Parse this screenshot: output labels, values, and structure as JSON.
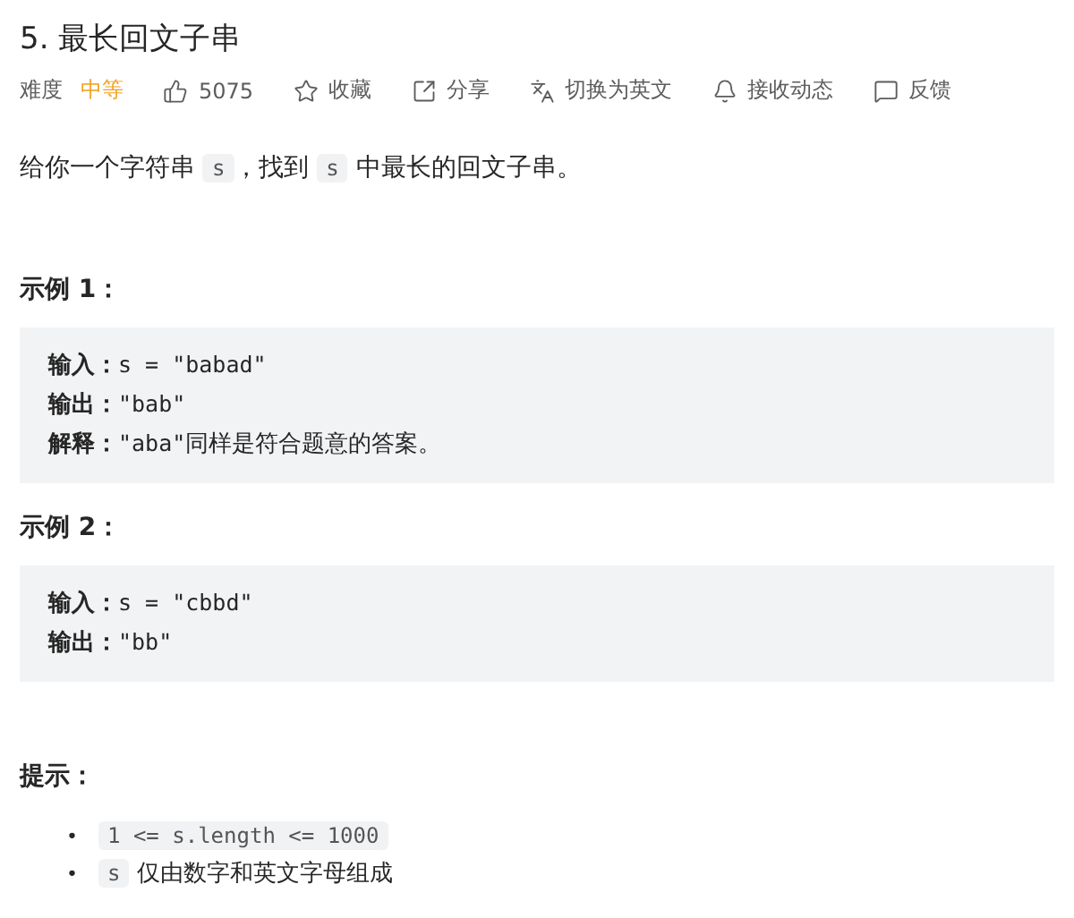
{
  "title": "5. 最长回文子串",
  "difficulty": {
    "label": "难度",
    "value": "中等"
  },
  "actions": [
    {
      "label": "5075"
    },
    {
      "label": "收藏"
    },
    {
      "label": "分享"
    },
    {
      "label": "切换为英文"
    },
    {
      "label": "接收动态"
    },
    {
      "label": "反馈"
    }
  ],
  "description": [
    {
      "kind": "text",
      "text": "给你一个字符串 "
    },
    {
      "kind": "code",
      "text": "s"
    },
    {
      "kind": "text",
      "text": "，找到 "
    },
    {
      "kind": "code",
      "text": "s"
    },
    {
      "kind": "text",
      "text": " 中最长的回文子串。"
    }
  ],
  "examples": [
    {
      "heading": "示例 1：",
      "lines": [
        {
          "label": "输入：",
          "value": "s = \"babad\""
        },
        {
          "label": "输出：",
          "value": "\"bab\""
        },
        {
          "label": "解释：",
          "value": "\"aba\"",
          "note": " 同样是符合题意的答案。"
        }
      ]
    },
    {
      "heading": "示例 2：",
      "lines": [
        {
          "label": "输入：",
          "value": "s = \"cbbd\""
        },
        {
          "label": "输出：",
          "value": "\"bb\""
        }
      ]
    }
  ],
  "hints": {
    "heading": "提示：",
    "items": [
      [
        {
          "kind": "bullet",
          "text": "•"
        },
        {
          "kind": "code",
          "text": "1 <= s.length <= 1000"
        }
      ],
      [
        {
          "kind": "bullet",
          "text": "•"
        },
        {
          "kind": "code",
          "text": "s"
        },
        {
          "kind": "text",
          "text": " 仅由数字和英文字母组成"
        }
      ]
    ]
  }
}
